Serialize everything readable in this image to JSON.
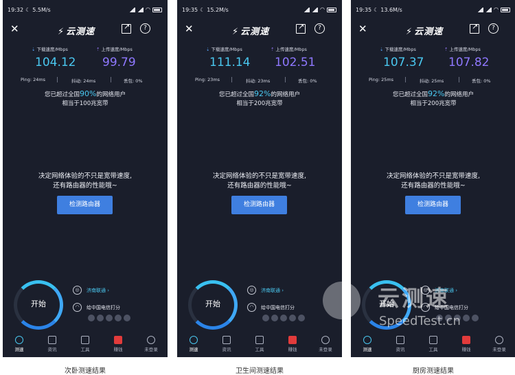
{
  "screens": [
    {
      "time": "19:32",
      "speed": "5.5M/s",
      "battery": "65",
      "download_label": "下载速度/Mbps",
      "upload_label": "上传速度/Mbps",
      "download": "104.12",
      "upload": "99.79",
      "ping": "Ping: 24ms",
      "jitter": "抖动: 24ms",
      "loss": "丢包: 0%",
      "rank_pre": "您已超过全国",
      "rank_pct": "90%",
      "rank_post": "的网络用户",
      "equiv": "相当于100兆宽带",
      "caption": "次卧测速结果"
    },
    {
      "time": "19:35",
      "speed": "15.2M/s",
      "battery": "65",
      "download_label": "下载速度/Mbps",
      "upload_label": "上传速度/Mbps",
      "download": "111.14",
      "upload": "102.51",
      "ping": "Ping: 23ms",
      "jitter": "抖动: 23ms",
      "loss": "丢包: 0%",
      "rank_pre": "您已超过全国",
      "rank_pct": "92%",
      "rank_post": "的网络用户",
      "equiv": "相当于200兆宽带",
      "caption": "卫生间测速结果"
    },
    {
      "time": "19:35",
      "speed": "13.6M/s",
      "battery": "65",
      "download_label": "下载速度/Mbps",
      "upload_label": "上传速度/Mbps",
      "download": "107.37",
      "upload": "107.82",
      "ping": "Ping: 25ms",
      "jitter": "抖动: 25ms",
      "loss": "丢包: 0%",
      "rank_pre": "您已超过全国",
      "rank_pct": "92%",
      "rank_post": "的网络用户",
      "equiv": "相当于200兆宽带",
      "caption": "厨房测速结果"
    }
  ],
  "common": {
    "logo": "云测速",
    "close_icon": "close-icon",
    "share_icon": "share-icon",
    "help": "?",
    "promo_line1": "决定网络体验的不只是宽带速度,",
    "promo_line2": "还有路由器的性能哦~",
    "detect_button": "检测路由器",
    "start": "开始",
    "isp": "济南联通 ›",
    "rate": "给中国电信打分",
    "nav": [
      "测速",
      "资讯",
      "工具",
      "赚钱",
      "未登录"
    ]
  },
  "watermark": {
    "line1": "云测速",
    "line2": "SpeedTest.cn"
  }
}
